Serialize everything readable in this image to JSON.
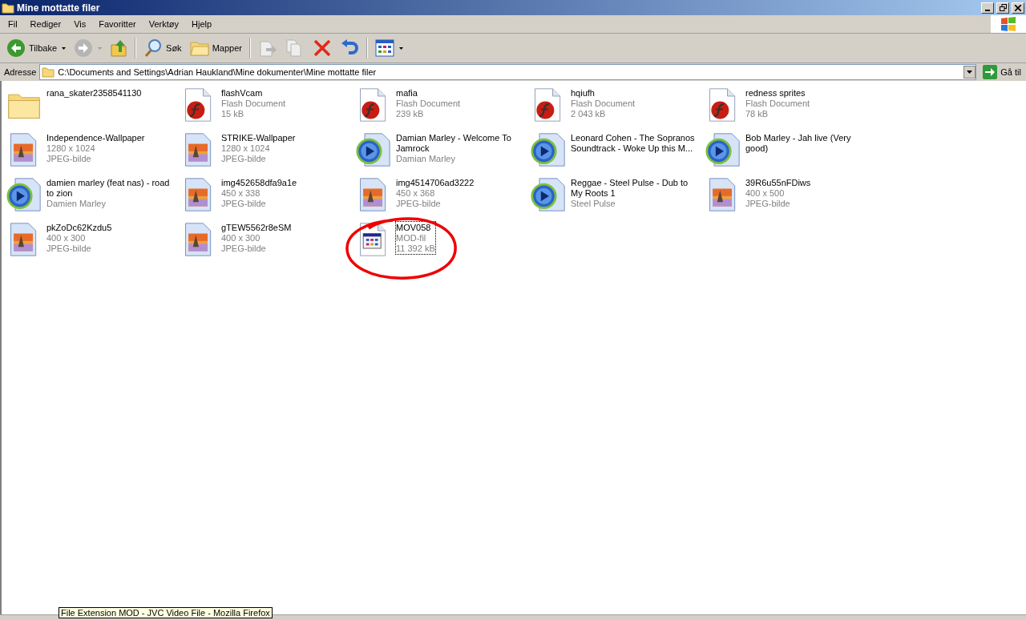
{
  "window": {
    "title": "Mine mottatte filer"
  },
  "menu": [
    "Fil",
    "Rediger",
    "Vis",
    "Favoritter",
    "Verktøy",
    "Hjelp"
  ],
  "toolbar": [
    {
      "kind": "back",
      "label": "Tilbake",
      "disabled": false
    },
    {
      "kind": "forward",
      "disabled": true
    },
    {
      "kind": "up",
      "disabled": false
    },
    {
      "kind": "search",
      "label": "Søk",
      "disabled": false
    },
    {
      "kind": "folders",
      "label": "Mapper",
      "disabled": false
    },
    {
      "kind": "move",
      "disabled": true
    },
    {
      "kind": "copy",
      "disabled": true
    },
    {
      "kind": "delete",
      "disabled": false
    },
    {
      "kind": "undo",
      "disabled": false
    },
    {
      "kind": "views",
      "disabled": false
    }
  ],
  "address": {
    "label": "Adresse",
    "value": "C:\\Documents and Settings\\Adrian Haukland\\Mine dokumenter\\Mine mottatte filer",
    "go": "Gå til"
  },
  "files": [
    {
      "kind": "folder",
      "name": "rana_skater2358541130",
      "selected": false
    },
    {
      "kind": "flash",
      "name": "flashVcam",
      "details": [
        "Flash Document",
        "15 kB"
      ],
      "selected": false
    },
    {
      "kind": "flash",
      "name": "mafia",
      "details": [
        "Flash Document",
        "239 kB"
      ],
      "selected": false
    },
    {
      "kind": "flash",
      "name": "hqiufh",
      "details": [
        "Flash Document",
        "2 043 kB"
      ],
      "selected": false
    },
    {
      "kind": "flash",
      "name": "redness sprites",
      "details": [
        "Flash Document",
        "78 kB"
      ],
      "selected": false
    },
    {
      "kind": "image",
      "name": "Independence-Wallpaper",
      "details": [
        "1280 x 1024",
        "JPEG-bilde"
      ],
      "selected": false
    },
    {
      "kind": "image",
      "name": "STRIKE-Wallpaper",
      "details": [
        "1280 x 1024",
        "JPEG-bilde"
      ],
      "selected": false
    },
    {
      "kind": "media",
      "name": "Damian Marley - Welcome To Jamrock",
      "details": [
        "Damian Marley"
      ],
      "selected": false
    },
    {
      "kind": "media",
      "name": "Leonard Cohen - The Sopranos Soundtrack - Woke Up this M...",
      "selected": false
    },
    {
      "kind": "media",
      "name": "Bob Marley - Jah live (Very good)",
      "selected": false
    },
    {
      "kind": "media",
      "name": "damien marley (feat nas) - road to zion",
      "details": [
        "Damien Marley"
      ],
      "selected": false
    },
    {
      "kind": "image",
      "name": "img452658dfa9a1e",
      "details": [
        "450 x 338",
        "JPEG-bilde"
      ],
      "selected": false
    },
    {
      "kind": "image",
      "name": "img4514706ad3222",
      "details": [
        "450 x 368",
        "JPEG-bilde"
      ],
      "selected": false
    },
    {
      "kind": "media",
      "name": "Reggae - Steel Pulse - Dub to My Roots 1",
      "details": [
        "Steel Pulse"
      ],
      "selected": false
    },
    {
      "kind": "image",
      "name": "39R6u55nFDiws",
      "details": [
        "400 x 500",
        "JPEG-bilde"
      ],
      "selected": false
    },
    {
      "kind": "image",
      "name": "pkZoDc62Kzdu5",
      "details": [
        "400 x 300",
        "JPEG-bilde"
      ],
      "selected": false
    },
    {
      "kind": "image",
      "name": "gTEW5562r8eSM",
      "details": [
        "400 x 300",
        "JPEG-bilde"
      ],
      "selected": false
    },
    {
      "kind": "mod",
      "name": "MOV058",
      "details": [
        "MOD-fil",
        "11 392 kB"
      ],
      "selected": true
    }
  ],
  "tooltip": "File Extension MOD - JVC Video File - Mozilla Firefox"
}
